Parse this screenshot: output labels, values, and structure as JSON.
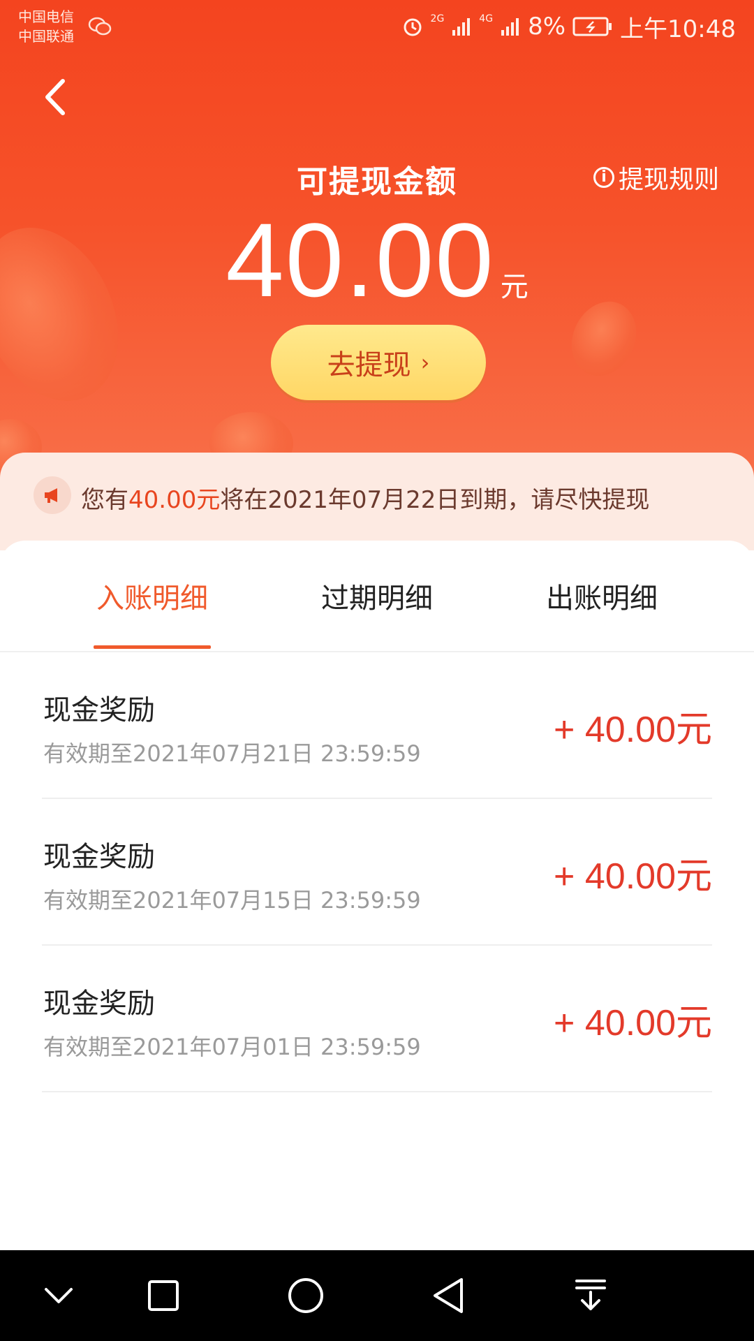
{
  "status_bar": {
    "carrier_1": "中国电信",
    "carrier_2": "中国联通",
    "network_1": "2G",
    "network_2": "4G",
    "battery": "8%",
    "time": "上午10:48"
  },
  "header": {
    "title": "可提现金额",
    "rules_label": "提现规则",
    "amount": "40.00",
    "unit": "元",
    "withdraw_label": "去提现"
  },
  "notice": {
    "prefix": "您有",
    "amount": "40.00元",
    "suffix": "将在2021年07月22日到期，请尽快提现"
  },
  "tabs": [
    {
      "label": "入账明细",
      "active": true
    },
    {
      "label": "过期明细",
      "active": false
    },
    {
      "label": "出账明细",
      "active": false
    }
  ],
  "records": [
    {
      "name": "现金奖励",
      "expiry": "有效期至2021年07月21日 23:59:59",
      "amount": "+ 40.00元"
    },
    {
      "name": "现金奖励",
      "expiry": "有效期至2021年07月15日 23:59:59",
      "amount": "+ 40.00元"
    },
    {
      "name": "现金奖励",
      "expiry": "有效期至2021年07月01日 23:59:59",
      "amount": "+ 40.00元"
    }
  ],
  "colors": {
    "brand": "#f4441f",
    "accent_text": "#f05a2c",
    "amount_text": "#e33a2a",
    "button_yellow": "#ffdf7a"
  },
  "icons": {
    "back": "chevron-left-icon",
    "rules": "info-icon",
    "notice": "megaphone-icon",
    "nav": [
      "chevron-down-icon",
      "square-icon",
      "circle-icon",
      "triangle-back-icon",
      "download-icon"
    ]
  }
}
